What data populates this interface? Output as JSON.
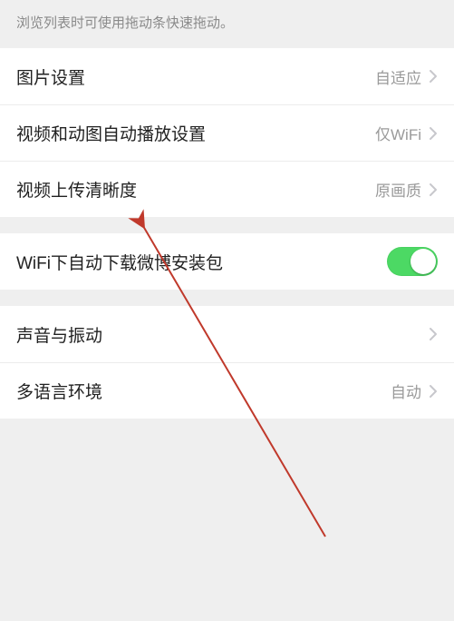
{
  "hint": "浏览列表时可使用拖动条快速拖动。",
  "rows": {
    "image_settings": {
      "label": "图片设置",
      "value": "自适应"
    },
    "video_autoplay": {
      "label": "视频和动图自动播放设置",
      "value": "仅WiFi"
    },
    "video_upload_quality": {
      "label": "视频上传清晰度",
      "value": "原画质"
    },
    "wifi_download_pkg": {
      "label": "WiFi下自动下载微博安装包"
    },
    "sound_vibration": {
      "label": "声音与振动"
    },
    "multilanguage": {
      "label": "多语言环境",
      "value": "自动"
    }
  }
}
